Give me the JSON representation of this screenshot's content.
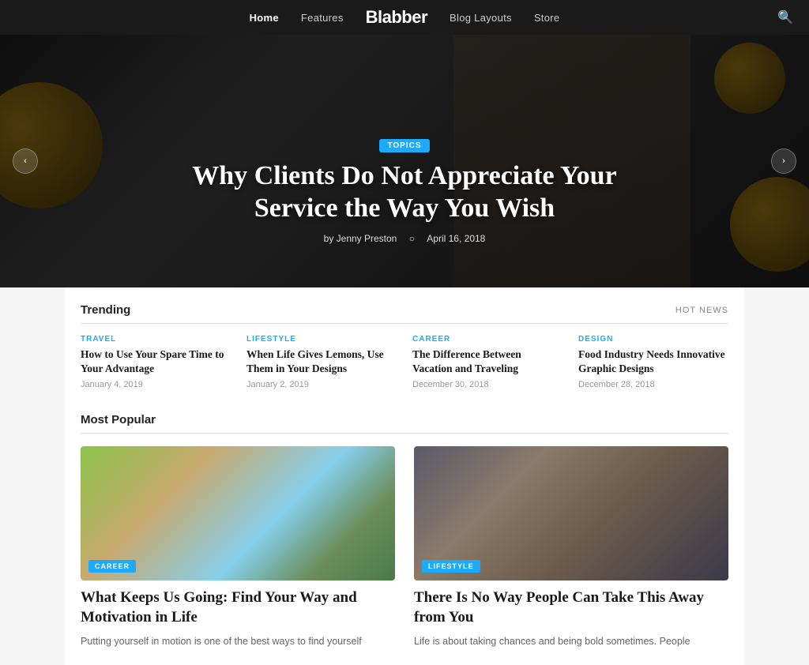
{
  "nav": {
    "logo": "Blabber",
    "links": [
      {
        "label": "Home",
        "active": true
      },
      {
        "label": "Features",
        "active": false
      },
      {
        "label": "Blog Layouts",
        "active": false
      },
      {
        "label": "Store",
        "active": false
      }
    ],
    "search_label": "🔍"
  },
  "hero": {
    "badge": "TOPICS",
    "title": "Why Clients Do Not Appreciate Your Service the Way You Wish",
    "author": "by Jenny Preston",
    "date": "April 16, 2018",
    "arrow_left": "‹",
    "arrow_right": "›"
  },
  "trending": {
    "title": "Trending",
    "hot_news": "HOT NEWS",
    "items": [
      {
        "category": "TRAVEL",
        "category_class": "cat-travel",
        "title": "How to Use Your Spare Time to Your Advantage",
        "date": "January 4, 2019"
      },
      {
        "category": "LIFESTYLE",
        "category_class": "cat-lifestyle",
        "title": "When Life Gives Lemons, Use Them in Your Designs",
        "date": "January 2, 2019"
      },
      {
        "category": "CAREER",
        "category_class": "cat-career",
        "title": "The Difference Between Vacation and Traveling",
        "date": "December 30, 2018"
      },
      {
        "category": "DESIGN",
        "category_class": "cat-design",
        "title": "Food Industry Needs Innovative Graphic Designs",
        "date": "December 28, 2018"
      }
    ]
  },
  "most_popular": {
    "title": "Most Popular",
    "items": [
      {
        "badge": "CAREER",
        "img_class": "img-running",
        "title": "What Keeps Us Going: Find Your Way and Motivation in Life",
        "desc": "Putting yourself in motion is one of the best ways to find yourself"
      },
      {
        "badge": "LIFESTYLE",
        "img_class": "img-studio",
        "title": "There Is No Way People Can Take This Away from You",
        "desc": "Life is about taking chances and being bold sometimes. People"
      }
    ]
  }
}
